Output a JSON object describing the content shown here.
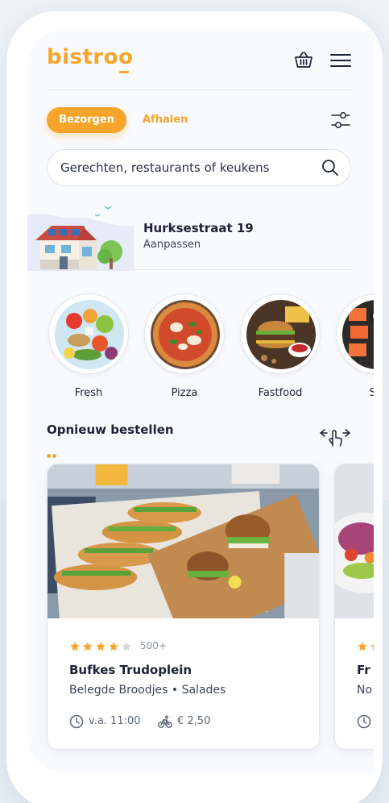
{
  "header": {
    "logo": "bistroo",
    "basket_icon": "basket-icon",
    "menu_icon": "hamburger-menu-icon"
  },
  "tabs": [
    {
      "label": "Bezorgen",
      "active": true
    },
    {
      "label": "Afhalen",
      "active": false
    }
  ],
  "filter_icon": "filter-sliders-icon",
  "search": {
    "placeholder": "Gerechten, restaurants of keukens",
    "icon": "search-icon"
  },
  "address": {
    "street": "Hurksestraat 19",
    "edit_label": "Aanpassen"
  },
  "categories": [
    {
      "label": "Fresh"
    },
    {
      "label": "Pizza"
    },
    {
      "label": "Fastfood"
    },
    {
      "label": "Su"
    }
  ],
  "reorder": {
    "title": "Opnieuw bestellen",
    "swipe_icon": "swipe-gesture-icon"
  },
  "restaurants": [
    {
      "rating": 4,
      "rating_max": 5,
      "rating_count": "500+",
      "name": "Bufkes Trudoplein",
      "cuisine": "Belegde Broodjes • Salades",
      "opening": "v.a. 11:00",
      "delivery_fee": "€ 2,50"
    },
    {
      "rating": 2,
      "rating_max": 5,
      "rating_count": "",
      "name": "Fr",
      "cuisine": "No",
      "opening": "",
      "delivery_fee": ""
    }
  ],
  "colors": {
    "accent": "#f7a52a",
    "text": "#1b2233",
    "muted": "#8a93a3"
  }
}
